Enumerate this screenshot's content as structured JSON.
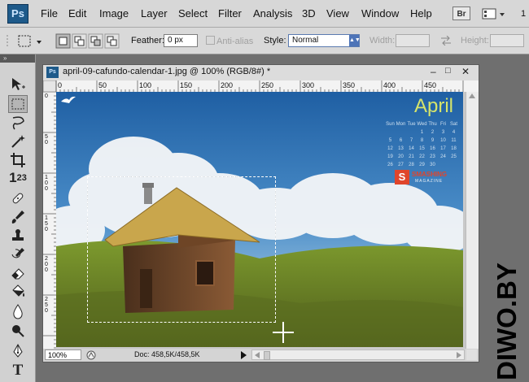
{
  "app": {
    "logo": "Ps",
    "logo_icon": "photoshop-logo"
  },
  "menu": {
    "items": [
      "File",
      "Edit",
      "Image",
      "Layer",
      "Select",
      "Filter",
      "Analysis",
      "3D",
      "View",
      "Window",
      "Help"
    ],
    "bridge": "Br",
    "zoom_partial": "1"
  },
  "options": {
    "feather_label": "Feather:",
    "feather_value": "0 px",
    "antialias_label": "Anti-alias",
    "style_label": "Style:",
    "style_value": "Normal",
    "width_label": "Width:",
    "height_label": "Height:"
  },
  "tools": [
    "move-tool-icon",
    "rectangular-marquee-icon",
    "lasso-icon",
    "magic-wand-icon",
    "crop-icon",
    "count-123-icon",
    "healing-brush-icon",
    "brush-icon",
    "clone-stamp-icon",
    "history-brush-icon",
    "eraser-icon",
    "paint-bucket-icon",
    "blur-drop-icon",
    "dodge-icon",
    "pen-icon",
    "type-icon"
  ],
  "document": {
    "title": "april-09-cafundo-calendar-1.jpg @ 100% (RGB/8#) *",
    "ruler_h": [
      "0",
      "50",
      "100",
      "150",
      "200",
      "250",
      "300",
      "350",
      "400",
      "450"
    ],
    "ruler_v": [
      "0",
      "5 0",
      "1 0 0",
      "1 5 0",
      "2 0 0",
      "2 5 0"
    ],
    "zoom": "100%",
    "doc_size": "Doc: 458,5K/458,5K"
  },
  "artwork": {
    "month": "April",
    "calendar_header": [
      "Sun",
      "Mon",
      "Tue",
      "Wed",
      "Thu",
      "Fri",
      "Sat"
    ],
    "calendar_rows": [
      [
        "",
        "",
        "",
        "1",
        "2",
        "3",
        "4"
      ],
      [
        "5",
        "6",
        "7",
        "8",
        "9",
        "10",
        "11"
      ],
      [
        "12",
        "13",
        "14",
        "15",
        "16",
        "17",
        "18"
      ],
      [
        "19",
        "20",
        "21",
        "22",
        "23",
        "24",
        "25"
      ],
      [
        "26",
        "27",
        "28",
        "29",
        "30",
        "",
        ""
      ]
    ],
    "brand_top": "SMASHING",
    "brand_bottom": "MAGAZINE",
    "brand_letter": "S"
  },
  "watermark": "DIWO.BY",
  "colors": {
    "accent": "#1e5a8a",
    "sky": "#4b8ec9",
    "grass": "#6f8a2a",
    "roof": "#c9a64c",
    "brand": "#e0452b"
  }
}
